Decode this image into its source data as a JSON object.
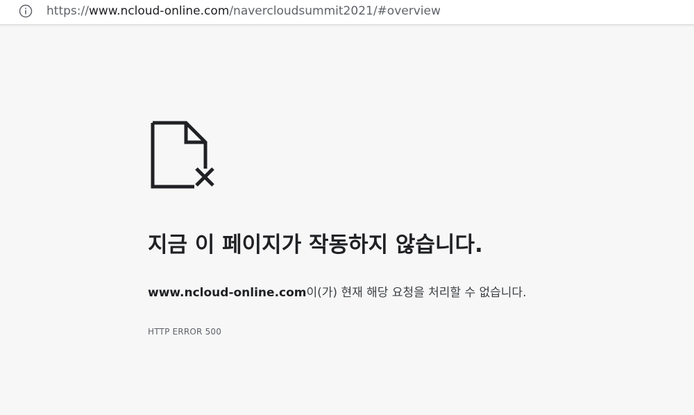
{
  "address_bar": {
    "url_prefix": "https://",
    "url_domain": "www.ncloud-online.com",
    "url_path": "/navercloudsummit2021/#overview",
    "icon": "info-icon"
  },
  "error_page": {
    "icon": "broken-page-icon",
    "headline": "지금 이 페이지가 작동하지 않습니다.",
    "host": "www.ncloud-online.com",
    "message_suffix": "이(가) 현재 해당 요청을 처리할 수 없습니다.",
    "error_code": "HTTP ERROR 500"
  },
  "colors": {
    "background": "#f7f7f7",
    "text_primary": "#202124",
    "text_secondary": "#5f6368"
  }
}
